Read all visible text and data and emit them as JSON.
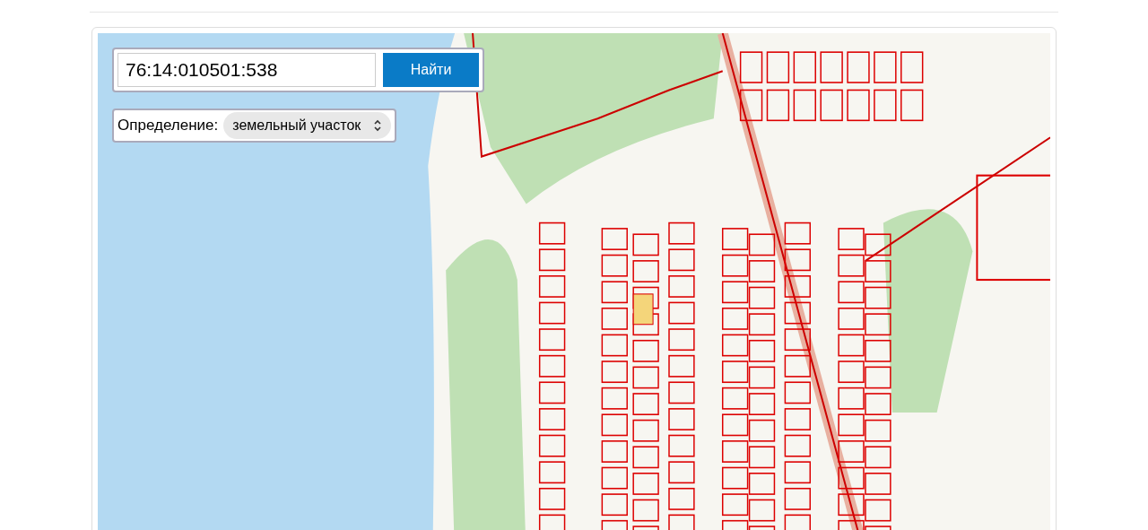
{
  "search": {
    "value": "76:14:010501:538",
    "button": "Найти"
  },
  "definition": {
    "label": "Определение:",
    "value": "земельный участок"
  }
}
